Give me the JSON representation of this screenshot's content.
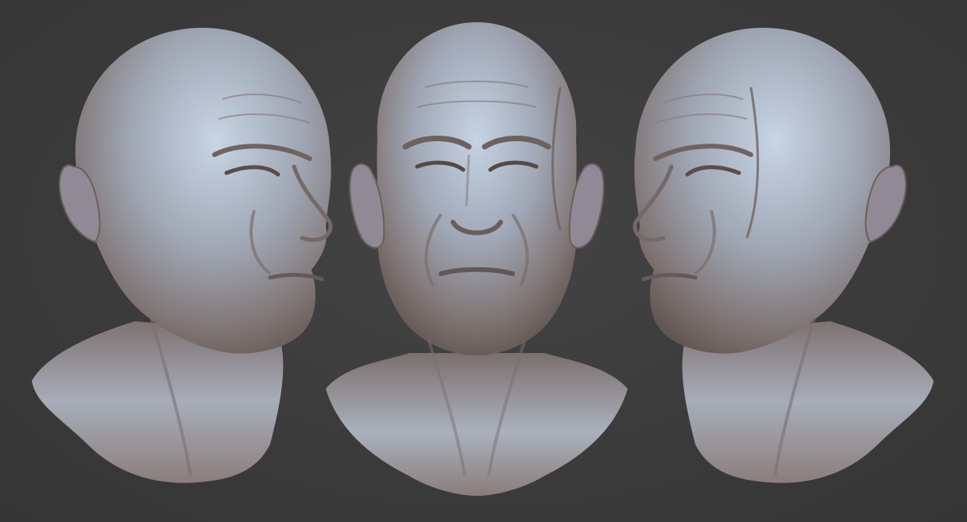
{
  "scene": {
    "background_color": "#3b3b3b",
    "material_shadow": "#6a5c58",
    "material_mid": "#8e8a92",
    "material_highlight": "#c9d6e6",
    "views": [
      {
        "label": "three-quarter-left"
      },
      {
        "label": "front"
      },
      {
        "label": "three-quarter-right"
      }
    ]
  }
}
